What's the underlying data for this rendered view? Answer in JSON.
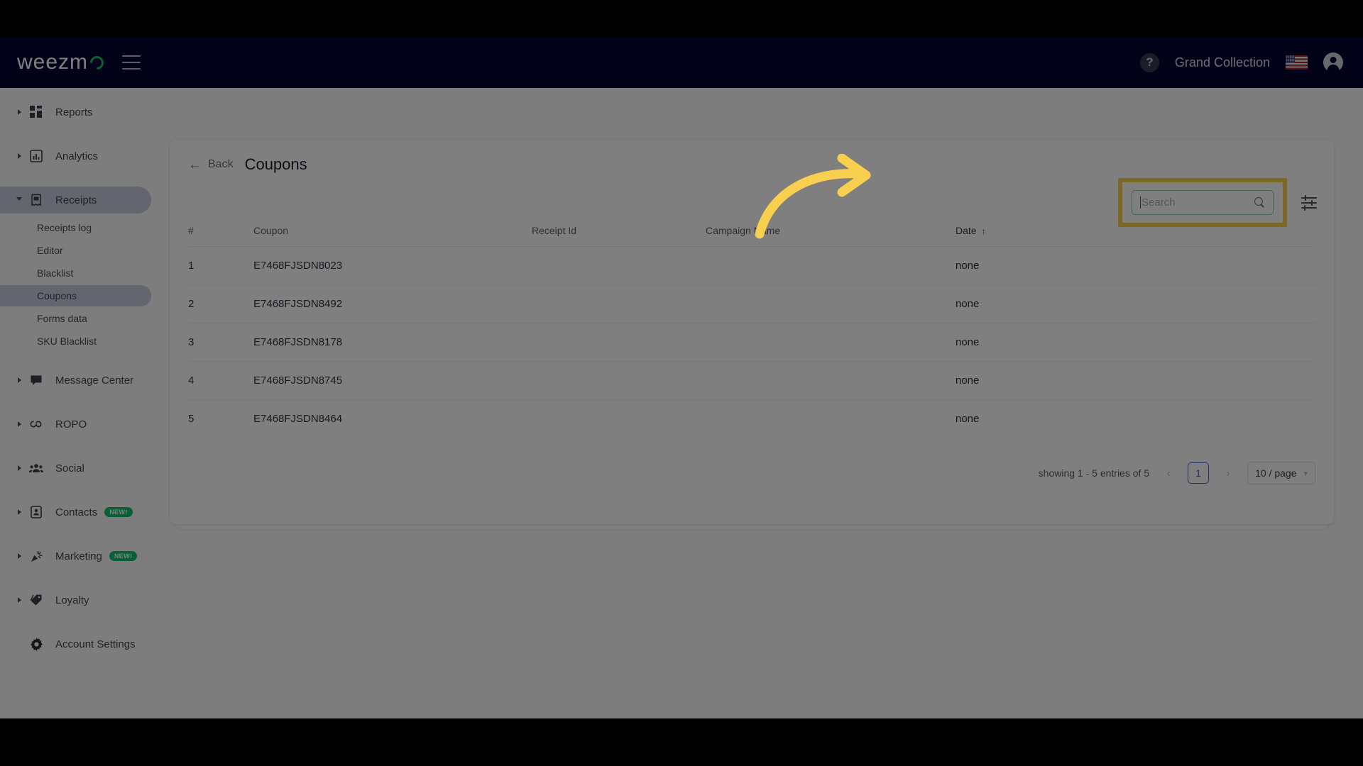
{
  "navbar": {
    "brand": "weezm",
    "brand_suffix_icon": "logo-circle",
    "menu_icon": "hamburger-icon",
    "help_label": "?",
    "account_name": "Grand Collection",
    "flag_icon": "us-flag-icon",
    "avatar_icon": "user-avatar-icon"
  },
  "sidebar": {
    "items": [
      {
        "label": "Reports",
        "icon": "dashboard-icon",
        "expanded": false,
        "active": false,
        "badge": ""
      },
      {
        "label": "Analytics",
        "icon": "bar-chart-icon",
        "expanded": false,
        "active": false,
        "badge": ""
      },
      {
        "label": "Receipts",
        "icon": "receipt-icon",
        "expanded": true,
        "active": true,
        "badge": ""
      },
      {
        "label": "Message Center",
        "icon": "chat-icon",
        "expanded": false,
        "active": false,
        "badge": ""
      },
      {
        "label": "ROPO",
        "icon": "infinity-icon",
        "expanded": false,
        "active": false,
        "badge": ""
      },
      {
        "label": "Social",
        "icon": "people-icon",
        "expanded": false,
        "active": false,
        "badge": ""
      },
      {
        "label": "Contacts",
        "icon": "contact-card-icon",
        "expanded": false,
        "active": false,
        "badge": "NEW!"
      },
      {
        "label": "Marketing",
        "icon": "megaphone-icon",
        "expanded": false,
        "active": false,
        "badge": "NEW!"
      },
      {
        "label": "Loyalty",
        "icon": "tag-icon",
        "expanded": false,
        "active": false,
        "badge": ""
      },
      {
        "label": "Account Settings",
        "icon": "gear-icon",
        "expanded": false,
        "active": false,
        "badge": ""
      }
    ],
    "receipts_children": [
      {
        "label": "Receipts log",
        "active": false
      },
      {
        "label": "Editor",
        "active": false
      },
      {
        "label": "Blacklist",
        "active": false
      },
      {
        "label": "Coupons",
        "active": true
      },
      {
        "label": "Forms data",
        "active": false
      },
      {
        "label": "SKU Blacklist",
        "active": false
      }
    ]
  },
  "card": {
    "back_label": "Back",
    "back_icon": "arrow-left-icon",
    "title": "Coupons"
  },
  "search": {
    "placeholder": "Search",
    "value": "",
    "icon": "search-icon",
    "highlight_color": "#f8cf4e",
    "border_color": "#7fcfa4"
  },
  "filter": {
    "icon": "filter-sliders-icon"
  },
  "table": {
    "headers": [
      "#",
      "Coupon",
      "Receipt Id",
      "Campaign Name",
      "Date"
    ],
    "sort_column": "Date",
    "sort_arrow": "↑",
    "rows": [
      {
        "num": "1",
        "coupon": "E7468FJSDN8023",
        "receipt_id": "",
        "campaign_name": "",
        "date": "none"
      },
      {
        "num": "2",
        "coupon": "E7468FJSDN8492",
        "receipt_id": "",
        "campaign_name": "",
        "date": "none"
      },
      {
        "num": "3",
        "coupon": "E7468FJSDN8178",
        "receipt_id": "",
        "campaign_name": "",
        "date": "none"
      },
      {
        "num": "4",
        "coupon": "E7468FJSDN8745",
        "receipt_id": "",
        "campaign_name": "",
        "date": "none"
      },
      {
        "num": "5",
        "coupon": "E7468FJSDN8464",
        "receipt_id": "",
        "campaign_name": "",
        "date": "none"
      }
    ]
  },
  "pagination": {
    "showing": "showing 1 - 5 entries of 5",
    "prev_icon": "chevron-left-icon",
    "next_icon": "chevron-right-icon",
    "current_page": "1",
    "page_size": "10 / page",
    "page_size_chevron": "⌄"
  },
  "annotation": {
    "arrow_icon": "curved-arrow-right",
    "color": "#f8cf4e"
  }
}
